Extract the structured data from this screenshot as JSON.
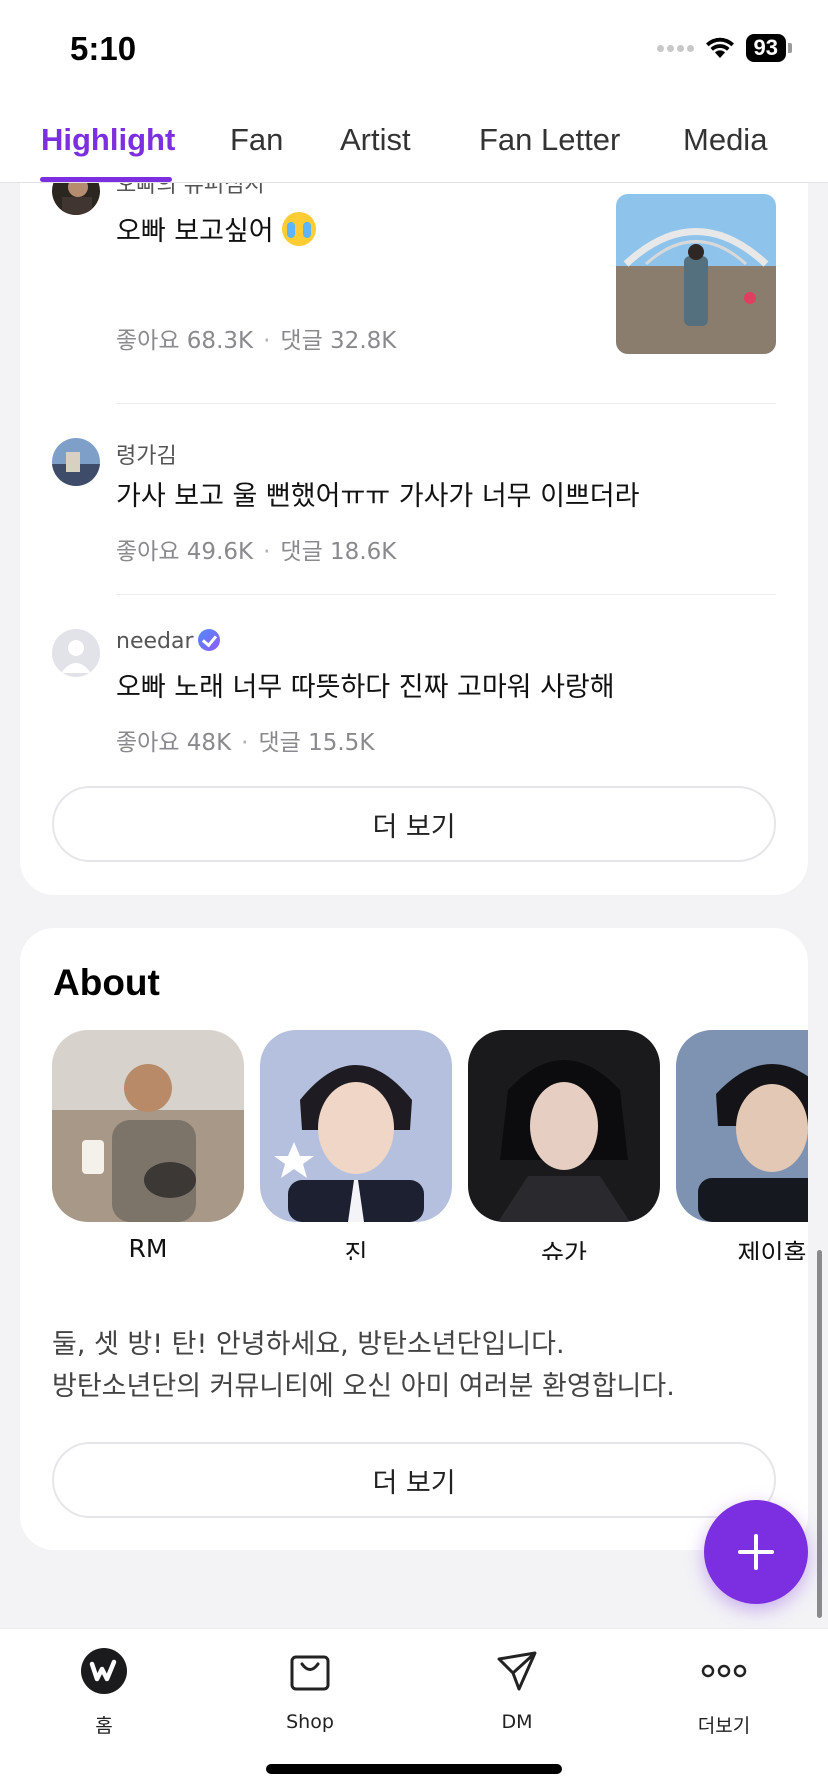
{
  "status_bar": {
    "time": "5:10",
    "battery": "93"
  },
  "tabs": [
    {
      "label": "Highlight",
      "active": true
    },
    {
      "label": "Fan",
      "active": false
    },
    {
      "label": "Artist",
      "active": false
    },
    {
      "label": "Fan Letter",
      "active": false
    },
    {
      "label": "Media",
      "active": false
    }
  ],
  "posts": [
    {
      "author": "오빠의 뉴퍼심시",
      "text": "오빠 보고싶어",
      "likes_label": "좋아요",
      "likes": "68.3K",
      "comments_label": "댓글",
      "comments": "32.8K",
      "has_thumbnail": true
    },
    {
      "author": "령가김",
      "text": "가사 보고 울 뻔했어ㅠㅠ  가사가 너무 이쁘더라",
      "likes_label": "좋아요",
      "likes": "49.6K",
      "comments_label": "댓글",
      "comments": "18.6K"
    },
    {
      "author": "needar",
      "text": "오빠 노래 너무 따뜻하다 진짜 고마워 사랑해",
      "likes_label": "좋아요",
      "likes": "48K",
      "comments_label": "댓글",
      "comments": "15.5K",
      "verified": true
    }
  ],
  "posts_more_label": "더 보기",
  "about": {
    "title": "About",
    "members": [
      {
        "name": "RM"
      },
      {
        "name": "진"
      },
      {
        "name": "슈가"
      },
      {
        "name": "제이홉"
      }
    ],
    "description_line1": "둘, 셋 방! 탄! 안녕하세요, 방탄소년단입니다.",
    "description_line2": "방탄소년단의 커뮤니티에 오신 아미 여러분 환영합니다.",
    "more_label": "더 보기"
  },
  "fab": {
    "icon": "plus-icon"
  },
  "bottom_nav": [
    {
      "label": "홈",
      "icon": "weverse-home-icon"
    },
    {
      "label": "Shop",
      "icon": "shopping-bag-icon"
    },
    {
      "label": "DM",
      "icon": "paper-plane-icon"
    },
    {
      "label": "더보기",
      "icon": "more-dots-icon"
    }
  ],
  "colors": {
    "accent": "#7c2fe0",
    "background": "#f3f3f6",
    "card": "#ffffff"
  }
}
